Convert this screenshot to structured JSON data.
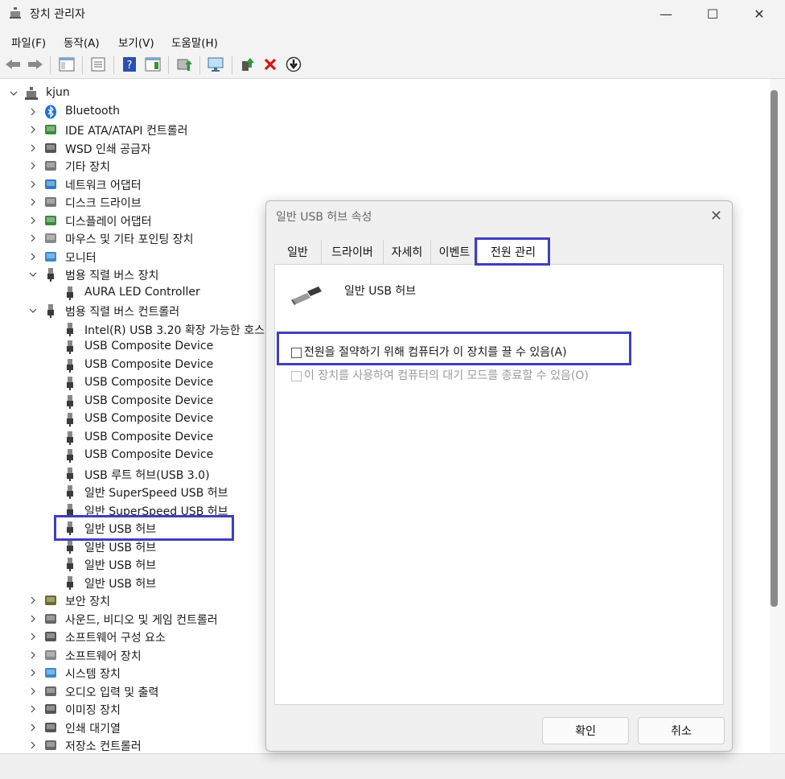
{
  "window": {
    "title": "장치 관리자",
    "min": "—",
    "max": "☐",
    "close": "✕"
  },
  "menu": [
    "파일(F)",
    "동작(A)",
    "보기(V)",
    "도움말(H)"
  ],
  "tree": {
    "root": "kjun",
    "categories": [
      {
        "label": "Bluetooth",
        "icon": "bluetooth-icon"
      },
      {
        "label": "IDE ATA/ATAPI 컨트롤러",
        "icon": "ide-controller-icon"
      },
      {
        "label": "WSD 인쇄 공급자",
        "icon": "printer-icon"
      },
      {
        "label": "기타 장치",
        "icon": "unknown-device-icon"
      },
      {
        "label": "네트워크 어댑터",
        "icon": "network-adapter-icon"
      },
      {
        "label": "디스크 드라이브",
        "icon": "disk-drive-icon"
      },
      {
        "label": "디스플레이 어댑터",
        "icon": "display-adapter-icon"
      },
      {
        "label": "마우스 및 기타 포인팅 장치",
        "icon": "mouse-icon"
      },
      {
        "label": "모니터",
        "icon": "monitor-icon"
      }
    ],
    "usb_devices_category": "범용 직렬 버스 장치",
    "usb_devices_children": [
      "AURA LED Controller"
    ],
    "usb_controllers_category": "범용 직렬 버스 컨트롤러",
    "usb_controllers_children": [
      "Intel(R) USB 3.20 확장 가능한 호스",
      "USB Composite Device",
      "USB Composite Device",
      "USB Composite Device",
      "USB Composite Device",
      "USB Composite Device",
      "USB Composite Device",
      "USB Composite Device",
      "USB 루트 허브(USB 3.0)",
      "일반 SuperSpeed USB 허브",
      "일반 SuperSpeed USB 허브",
      "일반 USB 허브",
      "일반 USB 허브",
      "일반 USB 허브",
      "일반 USB 허브"
    ],
    "more_categories": [
      {
        "label": "보안 장치",
        "icon": "security-device-icon"
      },
      {
        "label": "사운드, 비디오 및 게임 컨트롤러",
        "icon": "speaker-icon"
      },
      {
        "label": "소프트웨어 구성 요소",
        "icon": "software-component-icon"
      },
      {
        "label": "소프트웨어 장치",
        "icon": "software-device-icon"
      },
      {
        "label": "시스템 장치",
        "icon": "system-device-icon"
      },
      {
        "label": "오디오 입력 및 출력",
        "icon": "audio-icon"
      },
      {
        "label": "이미징 장치",
        "icon": "camera-icon"
      },
      {
        "label": "인쇄 대기열",
        "icon": "print-queue-icon"
      },
      {
        "label": "저장소 컨트롤러",
        "icon": "storage-controller-icon"
      }
    ]
  },
  "dialog": {
    "title": "일반 USB 허브 속성",
    "tabs": [
      "일반",
      "드라이버",
      "자세히",
      "이벤트",
      "전원 관리"
    ],
    "device_name": "일반 USB 허브",
    "option_allow_off": "전원을 절약하기 위해 컴퓨터가 이 장치를 끌 수 있음(A)",
    "option_allow_wake": "이 장치를 사용하여 컴퓨터의 대기 모드를 종료할 수 있음(O)",
    "ok": "확인",
    "cancel": "취소"
  },
  "colors": {
    "highlight": "#3f3fbf",
    "accent": "#0067c0"
  }
}
